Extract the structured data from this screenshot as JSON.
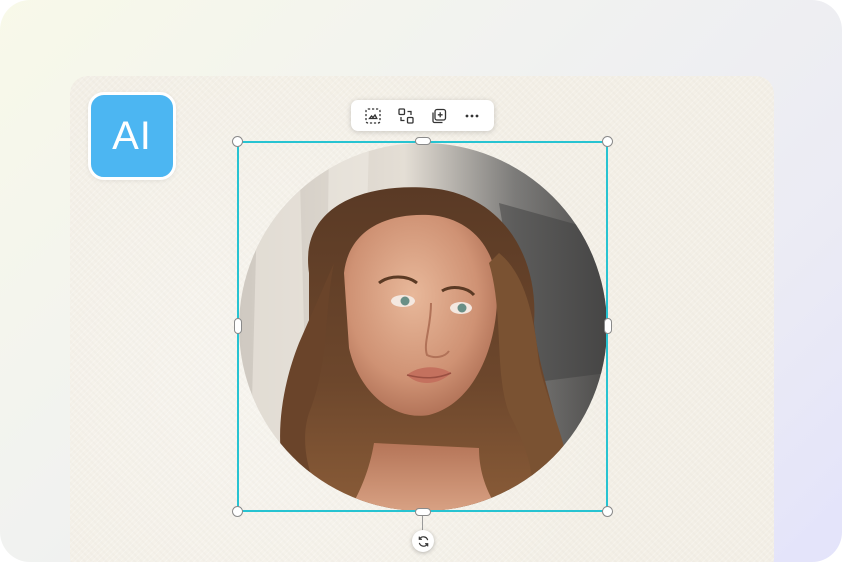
{
  "badge": {
    "label": "AI",
    "color": "#4cb6f2"
  },
  "toolbar": {
    "items": [
      {
        "icon": "crop-select-icon"
      },
      {
        "icon": "replace-icon"
      },
      {
        "icon": "duplicate-icon"
      },
      {
        "icon": "more-options-icon"
      }
    ]
  },
  "selection": {
    "color": "#27c3d1"
  },
  "image": {
    "subject": "portrait-photo"
  },
  "rotate": {
    "icon": "rotate-icon"
  }
}
